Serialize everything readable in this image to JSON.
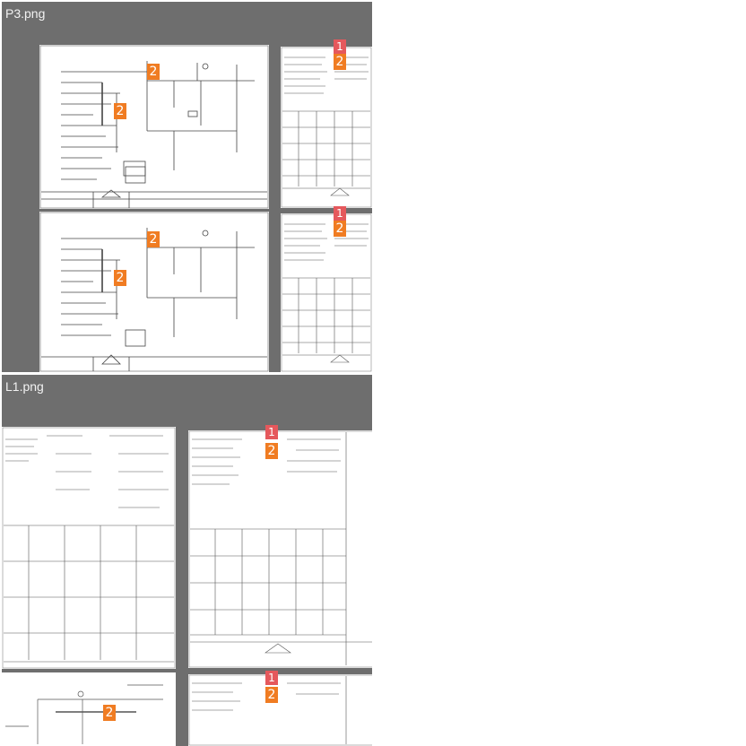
{
  "panels": [
    {
      "filename": "P3.png"
    },
    {
      "filename": "L1.png"
    }
  ],
  "markers": {
    "issue_high": "1",
    "issue_medium": "2"
  },
  "colors": {
    "panel_background": "#6e6e6e",
    "header_text": "#f2f2f2",
    "marker_orange": "#f07c22",
    "marker_red": "#e5585c"
  }
}
